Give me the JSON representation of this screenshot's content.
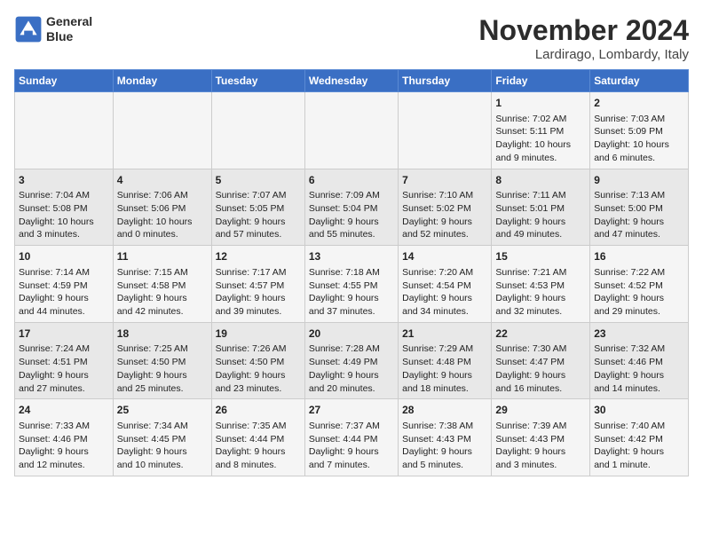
{
  "logo": {
    "line1": "General",
    "line2": "Blue"
  },
  "title": "November 2024",
  "subtitle": "Lardirago, Lombardy, Italy",
  "headers": [
    "Sunday",
    "Monday",
    "Tuesday",
    "Wednesday",
    "Thursday",
    "Friday",
    "Saturday"
  ],
  "weeks": [
    [
      {
        "day": "",
        "info": ""
      },
      {
        "day": "",
        "info": ""
      },
      {
        "day": "",
        "info": ""
      },
      {
        "day": "",
        "info": ""
      },
      {
        "day": "",
        "info": ""
      },
      {
        "day": "1",
        "info": "Sunrise: 7:02 AM\nSunset: 5:11 PM\nDaylight: 10 hours\nand 9 minutes."
      },
      {
        "day": "2",
        "info": "Sunrise: 7:03 AM\nSunset: 5:09 PM\nDaylight: 10 hours\nand 6 minutes."
      }
    ],
    [
      {
        "day": "3",
        "info": "Sunrise: 7:04 AM\nSunset: 5:08 PM\nDaylight: 10 hours\nand 3 minutes."
      },
      {
        "day": "4",
        "info": "Sunrise: 7:06 AM\nSunset: 5:06 PM\nDaylight: 10 hours\nand 0 minutes."
      },
      {
        "day": "5",
        "info": "Sunrise: 7:07 AM\nSunset: 5:05 PM\nDaylight: 9 hours\nand 57 minutes."
      },
      {
        "day": "6",
        "info": "Sunrise: 7:09 AM\nSunset: 5:04 PM\nDaylight: 9 hours\nand 55 minutes."
      },
      {
        "day": "7",
        "info": "Sunrise: 7:10 AM\nSunset: 5:02 PM\nDaylight: 9 hours\nand 52 minutes."
      },
      {
        "day": "8",
        "info": "Sunrise: 7:11 AM\nSunset: 5:01 PM\nDaylight: 9 hours\nand 49 minutes."
      },
      {
        "day": "9",
        "info": "Sunrise: 7:13 AM\nSunset: 5:00 PM\nDaylight: 9 hours\nand 47 minutes."
      }
    ],
    [
      {
        "day": "10",
        "info": "Sunrise: 7:14 AM\nSunset: 4:59 PM\nDaylight: 9 hours\nand 44 minutes."
      },
      {
        "day": "11",
        "info": "Sunrise: 7:15 AM\nSunset: 4:58 PM\nDaylight: 9 hours\nand 42 minutes."
      },
      {
        "day": "12",
        "info": "Sunrise: 7:17 AM\nSunset: 4:57 PM\nDaylight: 9 hours\nand 39 minutes."
      },
      {
        "day": "13",
        "info": "Sunrise: 7:18 AM\nSunset: 4:55 PM\nDaylight: 9 hours\nand 37 minutes."
      },
      {
        "day": "14",
        "info": "Sunrise: 7:20 AM\nSunset: 4:54 PM\nDaylight: 9 hours\nand 34 minutes."
      },
      {
        "day": "15",
        "info": "Sunrise: 7:21 AM\nSunset: 4:53 PM\nDaylight: 9 hours\nand 32 minutes."
      },
      {
        "day": "16",
        "info": "Sunrise: 7:22 AM\nSunset: 4:52 PM\nDaylight: 9 hours\nand 29 minutes."
      }
    ],
    [
      {
        "day": "17",
        "info": "Sunrise: 7:24 AM\nSunset: 4:51 PM\nDaylight: 9 hours\nand 27 minutes."
      },
      {
        "day": "18",
        "info": "Sunrise: 7:25 AM\nSunset: 4:50 PM\nDaylight: 9 hours\nand 25 minutes."
      },
      {
        "day": "19",
        "info": "Sunrise: 7:26 AM\nSunset: 4:50 PM\nDaylight: 9 hours\nand 23 minutes."
      },
      {
        "day": "20",
        "info": "Sunrise: 7:28 AM\nSunset: 4:49 PM\nDaylight: 9 hours\nand 20 minutes."
      },
      {
        "day": "21",
        "info": "Sunrise: 7:29 AM\nSunset: 4:48 PM\nDaylight: 9 hours\nand 18 minutes."
      },
      {
        "day": "22",
        "info": "Sunrise: 7:30 AM\nSunset: 4:47 PM\nDaylight: 9 hours\nand 16 minutes."
      },
      {
        "day": "23",
        "info": "Sunrise: 7:32 AM\nSunset: 4:46 PM\nDaylight: 9 hours\nand 14 minutes."
      }
    ],
    [
      {
        "day": "24",
        "info": "Sunrise: 7:33 AM\nSunset: 4:46 PM\nDaylight: 9 hours\nand 12 minutes."
      },
      {
        "day": "25",
        "info": "Sunrise: 7:34 AM\nSunset: 4:45 PM\nDaylight: 9 hours\nand 10 minutes."
      },
      {
        "day": "26",
        "info": "Sunrise: 7:35 AM\nSunset: 4:44 PM\nDaylight: 9 hours\nand 8 minutes."
      },
      {
        "day": "27",
        "info": "Sunrise: 7:37 AM\nSunset: 4:44 PM\nDaylight: 9 hours\nand 7 minutes."
      },
      {
        "day": "28",
        "info": "Sunrise: 7:38 AM\nSunset: 4:43 PM\nDaylight: 9 hours\nand 5 minutes."
      },
      {
        "day": "29",
        "info": "Sunrise: 7:39 AM\nSunset: 4:43 PM\nDaylight: 9 hours\nand 3 minutes."
      },
      {
        "day": "30",
        "info": "Sunrise: 7:40 AM\nSunset: 4:42 PM\nDaylight: 9 hours\nand 1 minute."
      }
    ]
  ]
}
